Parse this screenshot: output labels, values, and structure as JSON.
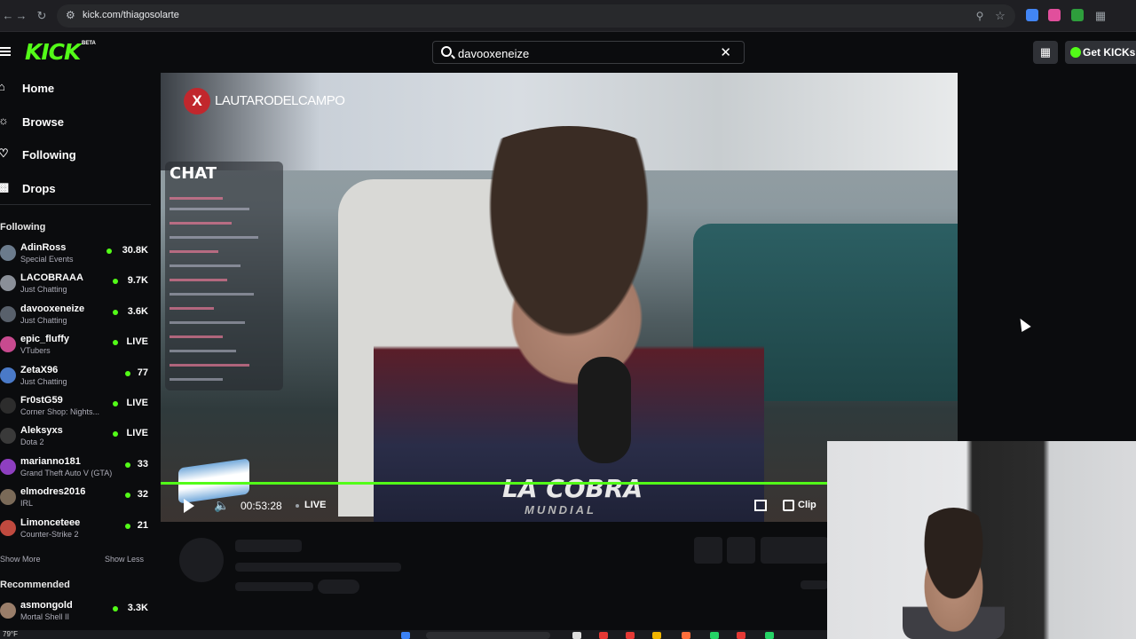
{
  "browser": {
    "url": "kick.com/thiagosolarte",
    "colors": {
      "extension_1": "#4285f4",
      "extension_2": "#e14f9c",
      "extension_3": "#2e9e3c"
    }
  },
  "header": {
    "logo": "KICK",
    "logo_badge": "BETA",
    "search_value": "davooxeneize",
    "get_kicks_label": "Get KICKs",
    "accent_color": "#53fc18"
  },
  "sidebar": {
    "nav": [
      {
        "label": "Home",
        "icon": "home-icon"
      },
      {
        "label": "Browse",
        "icon": "compass-icon"
      },
      {
        "label": "Following",
        "icon": "heart-icon"
      },
      {
        "label": "Drops",
        "icon": "gift-icon"
      }
    ],
    "following_title": "Following",
    "following": [
      {
        "name": "AdinRoss",
        "category": "Special Events",
        "viewers": "30.8K",
        "avatar_color": "#6b7b8c"
      },
      {
        "name": "LACOBRAAA",
        "category": "Just Chatting",
        "viewers": "9.7K",
        "avatar_color": "#8a8f98"
      },
      {
        "name": "davooxeneize",
        "category": "Just Chatting",
        "viewers": "3.6K",
        "avatar_color": "#58606b"
      },
      {
        "name": "epic_fluffy",
        "category": "VTubers",
        "viewers": "LIVE",
        "avatar_color": "#c84a8f"
      },
      {
        "name": "ZetaX96",
        "category": "Just Chatting",
        "viewers": "77",
        "avatar_color": "#4a7ac8"
      },
      {
        "name": "Fr0stG59",
        "category": "Corner Shop: Nights...",
        "viewers": "LIVE",
        "avatar_color": "#2d2d2d"
      },
      {
        "name": "Aleksyxs",
        "category": "Dota 2",
        "viewers": "LIVE",
        "avatar_color": "#3a3a3a"
      },
      {
        "name": "marianno181",
        "category": "Grand Theft Auto V (GTA)",
        "viewers": "33",
        "avatar_color": "#8e3fc0"
      },
      {
        "name": "elmodres2016",
        "category": "IRL",
        "viewers": "32",
        "avatar_color": "#7a6a58"
      },
      {
        "name": "Limonceteee",
        "category": "Counter-Strike 2",
        "viewers": "21",
        "avatar_color": "#c04a3f"
      }
    ],
    "show_more": "Show More",
    "show_less": "Show Less",
    "recommended_title": "Recommended",
    "recommended": [
      {
        "name": "asmongold",
        "category": "Mortal Shell II",
        "viewers": "3.3K",
        "avatar_color": "#9a7e6a"
      }
    ]
  },
  "player": {
    "overlay_handle": "LAUTARODELCAMPO",
    "overlay_x": "X",
    "chat_overlay_title": "CHAT",
    "brand_text": "LA COBRA",
    "brand_sub": "MUNDIAL",
    "time": "00:53:28",
    "live_label": "LIVE",
    "clip_label": "Clip"
  },
  "taskbar": {
    "temperature": "79°F"
  }
}
